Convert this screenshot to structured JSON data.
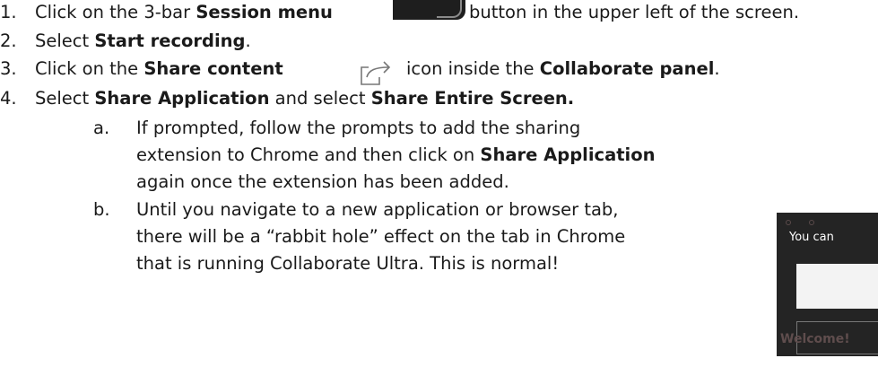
{
  "steps": [
    {
      "num": "1.",
      "pre": "Click on the 3-bar ",
      "bold": "Session menu",
      "post": " button in the upper left of the screen."
    },
    {
      "num": "2.",
      "pre": "Select ",
      "bold": "Start recording",
      "post": "."
    },
    {
      "num": "3.",
      "pre": "Click on the ",
      "bold": "Share content",
      "mid": " icon inside the ",
      "bold2": "Collaborate panel",
      "post": "."
    },
    {
      "num": "4.",
      "pre": "Select ",
      "bold": "Share Application",
      "mid": " and select ",
      "bold2": "Share Entire Screen."
    }
  ],
  "substeps": [
    {
      "letter": "a.",
      "line1": "If prompted, follow the prompts to add the sharing",
      "line2_pre": "extension to Chrome and then click on ",
      "line2_bold": "Share Application",
      "line3": "again once the extension has been added."
    },
    {
      "letter": "b.",
      "line1": "Until you navigate to a new application or browser tab,",
      "line2": "there will be a “rabbit hole” effect on the tab in Chrome",
      "line3": "that is running Collaborate Ultra.  This is normal!"
    }
  ],
  "thumbnail": {
    "text": "You can",
    "welcome": "Welcome!"
  },
  "icons": {
    "session_menu": "session-menu-button-image",
    "share": "share-content-icon"
  }
}
